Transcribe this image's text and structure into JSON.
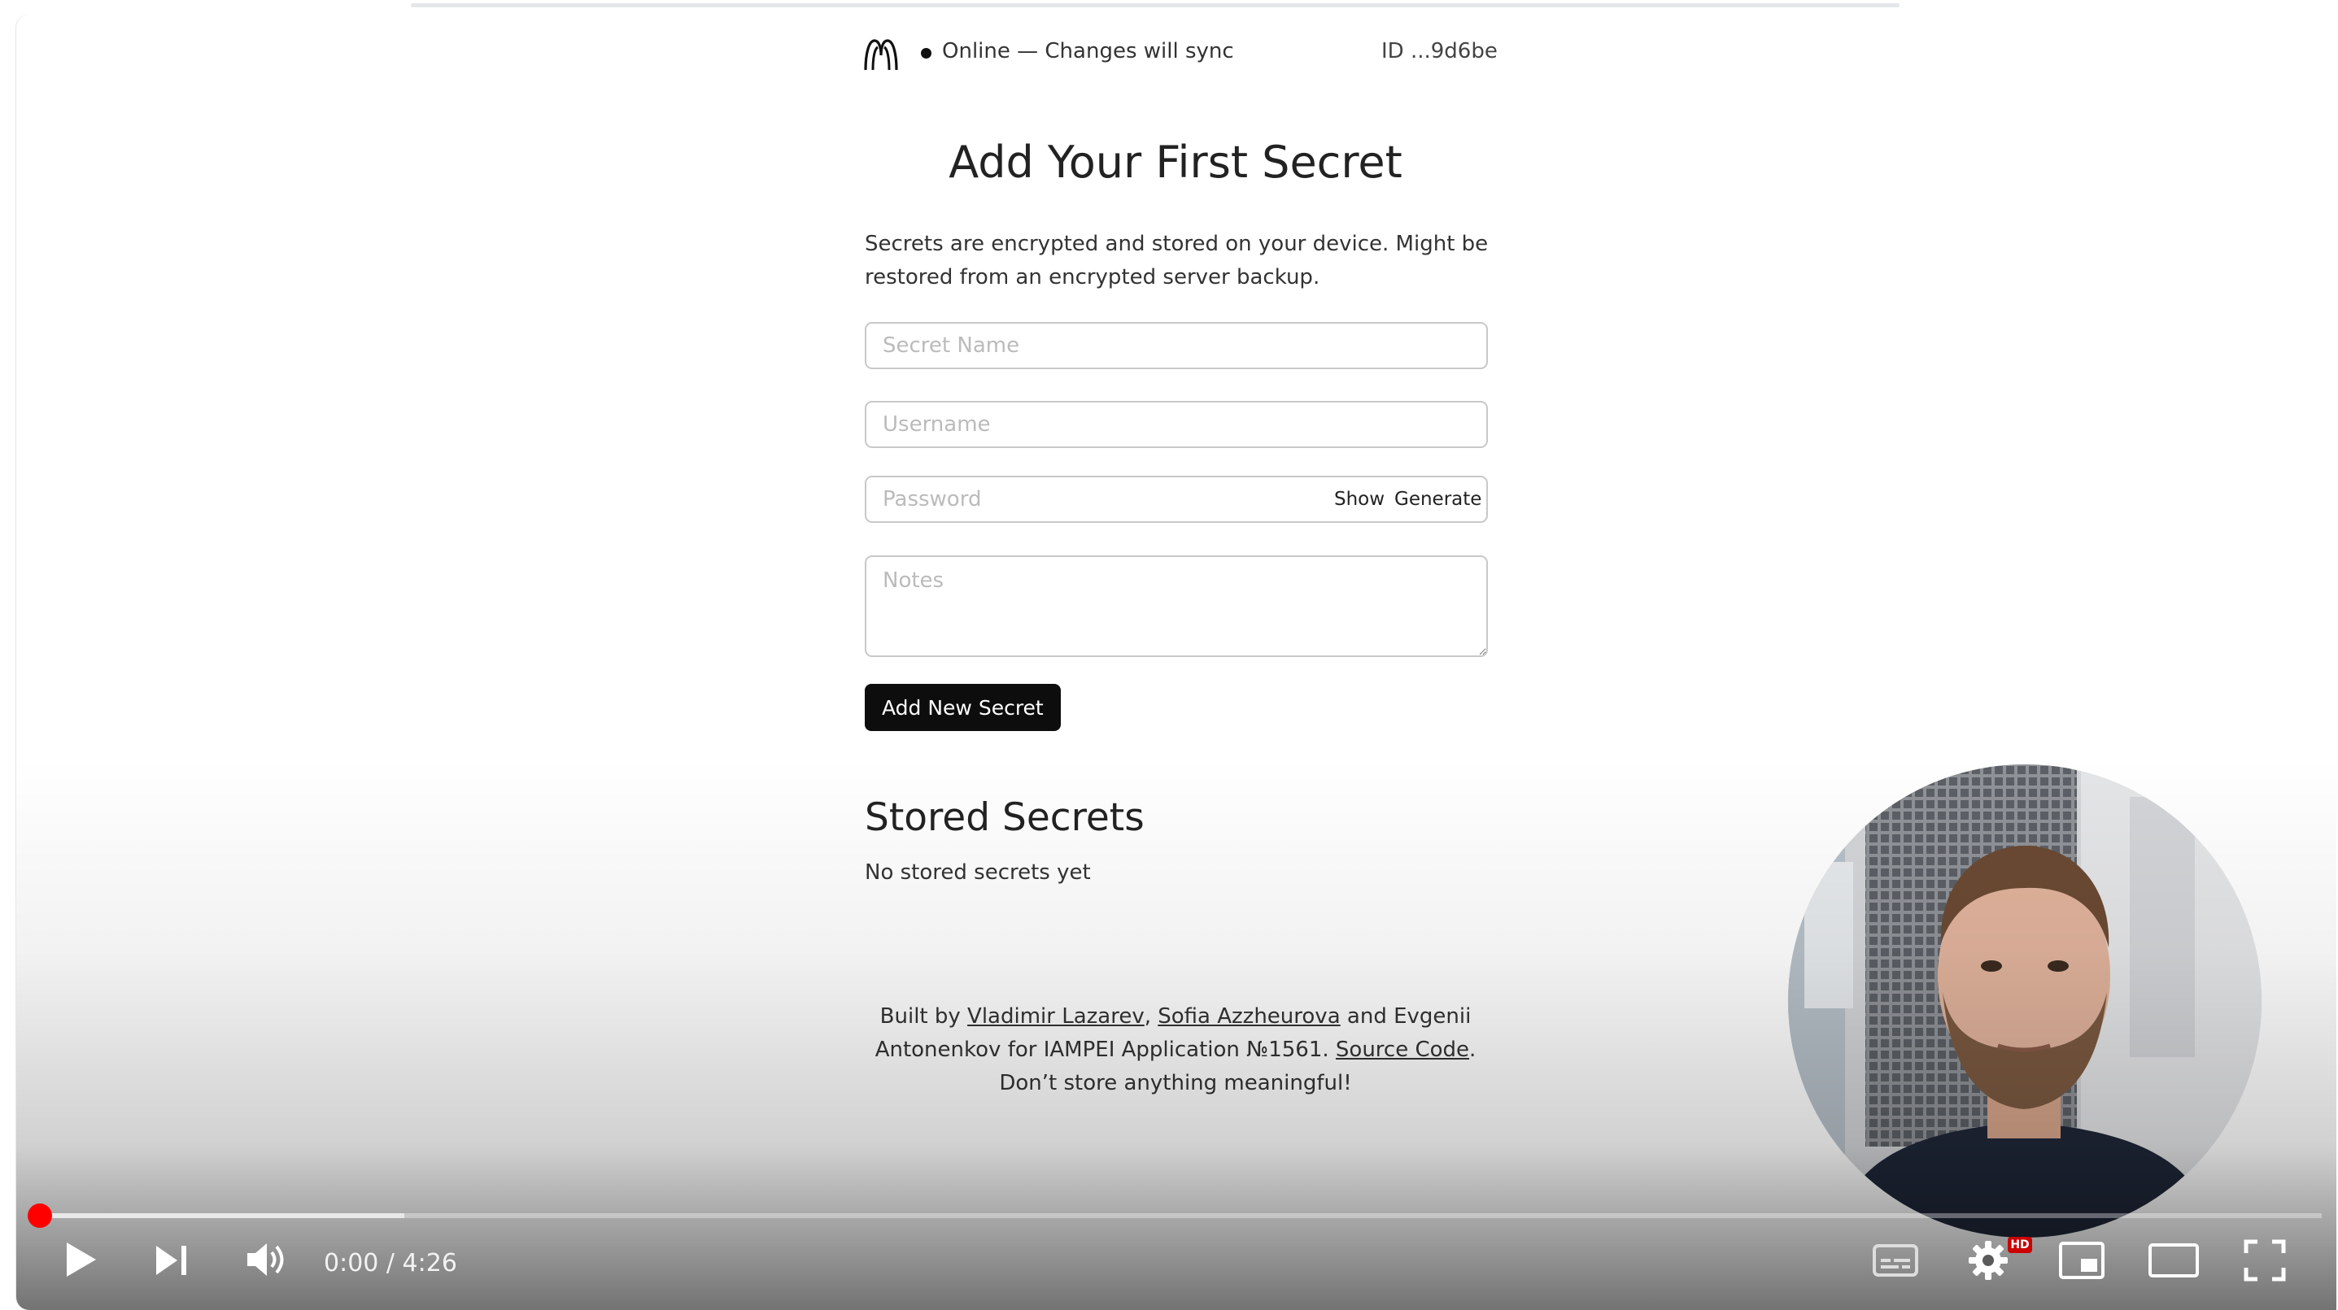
{
  "header": {
    "status": "Online — Changes will sync",
    "device_id": "ID ...9d6be"
  },
  "form": {
    "title": "Add Your First Secret",
    "intro": "Secrets are encrypted and stored on your device. Might be restored from an encrypted server backup.",
    "name_placeholder": "Secret Name",
    "username_placeholder": "Username",
    "password_placeholder": "Password",
    "notes_placeholder": "Notes",
    "show_label": "Show",
    "generate_label": "Generate",
    "submit_label": "Add New Secret"
  },
  "stored": {
    "title": "Stored Secrets",
    "empty_text": "No stored secrets yet"
  },
  "footer": {
    "built_by": "Built by",
    "author1": "Vladimir Lazarev",
    "sep": ",",
    "author2": "Sofia Azzheurova",
    "rest": "and Evgenii Antonenkov for IAMPEI Application №1561.",
    "source_link": "Source Code",
    "period": ".",
    "disclaimer": "Don’t store anything meaningful!"
  },
  "player": {
    "current_time": "0:00",
    "duration": "4:26",
    "time_display": "0:00 / 4:26",
    "hd_badge": "HD",
    "progress_played": 0,
    "buffered_fraction": 0.16,
    "accent_color": "#ff0000",
    "icons": [
      "play-icon",
      "next-icon",
      "volume-icon",
      "subtitles-icon",
      "settings-icon",
      "miniplayer-icon",
      "theater-icon",
      "fullscreen-icon"
    ]
  }
}
